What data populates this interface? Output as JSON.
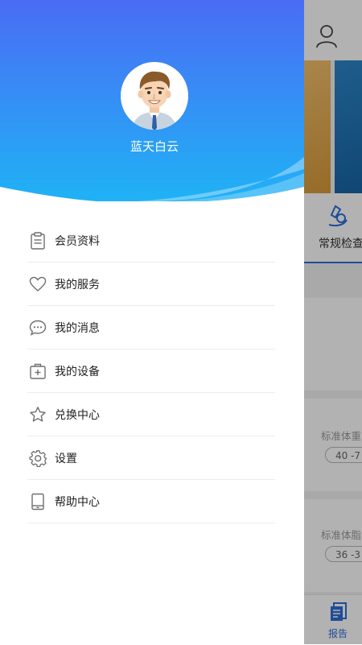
{
  "profile": {
    "username": "蓝天白云"
  },
  "menu": [
    {
      "label": "会员资料",
      "icon": "clipboard-icon"
    },
    {
      "label": "我的服务",
      "icon": "heart-icon"
    },
    {
      "label": "我的消息",
      "icon": "chat-bubble-icon"
    },
    {
      "label": "我的设备",
      "icon": "medical-kit-icon"
    },
    {
      "label": "兑换中心",
      "icon": "star-icon"
    },
    {
      "label": "设置",
      "icon": "gear-icon"
    },
    {
      "label": "帮助中心",
      "icon": "tablet-icon"
    }
  ],
  "background_app": {
    "tab_label": "常规检查",
    "card1_label": "标准体重",
    "card1_value": "40 -7",
    "card2_label": "标准体脂",
    "card2_value": "36 -3",
    "bottom_nav_label": "报告"
  },
  "colors": {
    "header_gradient_top": "#4a6cf5",
    "header_gradient_bottom": "#1fb3f5",
    "accent": "#2f6ed8"
  }
}
